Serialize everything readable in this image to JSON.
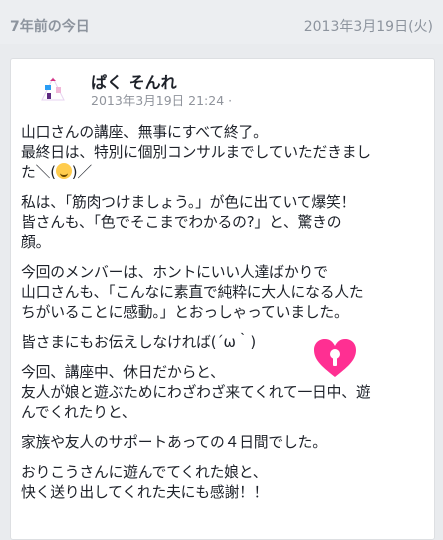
{
  "memory": {
    "title": "7年前の今日",
    "date": "2013年3月19日(火)"
  },
  "post": {
    "author": "ぱく そんれ",
    "timestamp": "2013年3月19日 21:24 ·",
    "paragraphs": [
      {
        "lines": [
          "山口さんの講座、無事にすべて終了。",
          "最終日は、特別に個別コンサルまでしていただきまし",
          "た＼("
        ]
      },
      {
        "lines": [
          "私は、「筋肉つけましょう。」が色に出ていて爆笑！",
          "皆さんも、「色でそこまでわかるの?」と、驚きの",
          "顔。"
        ]
      },
      {
        "lines": [
          "今回のメンバーは、ホントにいい人達ばかりで",
          "山口さんも、「こんなに素直で純粋に大人になる人た",
          "ちがいることに感動。」とおっしゃっていました。"
        ]
      },
      {
        "lines": [
          "皆さまにもお伝えしなければ(´ω｀)"
        ]
      },
      {
        "lines": [
          "今回、講座中、休日だからと、",
          "友人が娘と遊ぶためにわざわざ来てくれて一日中、遊",
          "んでくれたりと、"
        ]
      },
      {
        "lines": [
          "家族や友人のサポートあっての４日間でした。"
        ]
      },
      {
        "lines": [
          "おりこうさんに遊んでてくれた娘と、",
          "快く送り出してくれた夫にも感謝！！"
        ]
      }
    ],
    "emoji_suffix": ")／"
  },
  "colors": {
    "heart": "#ff2f92",
    "emoji": "#ffcc4d"
  },
  "icons": {
    "avatar": "avatar-icon",
    "heart": "heart-lock-icon"
  }
}
